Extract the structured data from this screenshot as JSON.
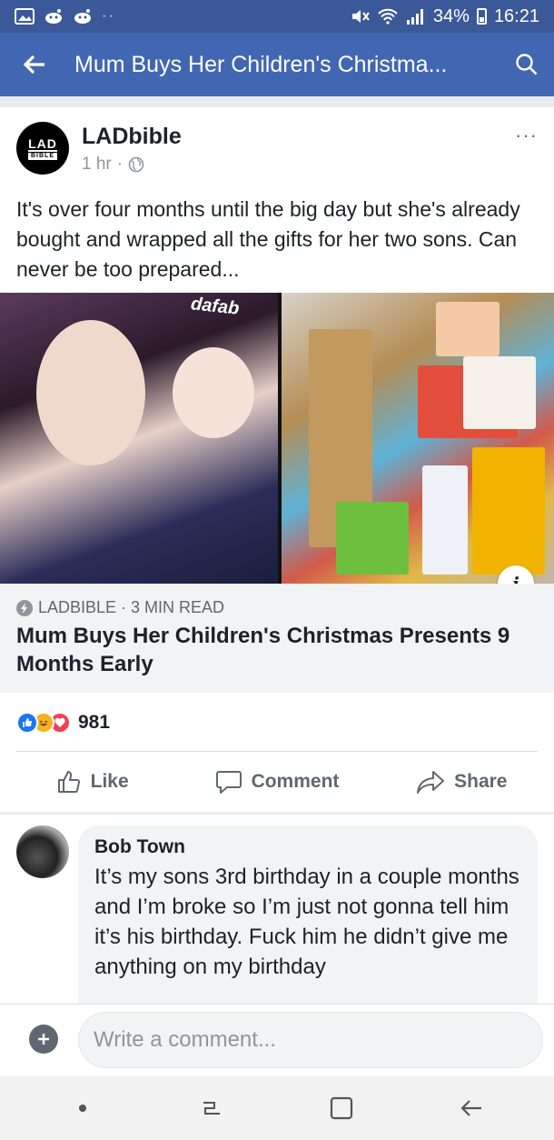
{
  "status_bar": {
    "battery": "34%",
    "time": "16:21",
    "dots": "··"
  },
  "app_bar": {
    "title": "Mum Buys Her Children's Christma..."
  },
  "post": {
    "page_name": "LADbible",
    "avatar_text_top": "LAD",
    "avatar_text_bottom": "BIBLE",
    "time": "1 hr",
    "separator": "·",
    "more": "···",
    "text": "It's over four months until the big day but she's already bought and wrapped all the gifts for her two sons. Can never be too prepared...",
    "image_watermark": "dafab",
    "info_glyph": "i",
    "link": {
      "source": "LADBIBLE · 3 MIN READ",
      "title": "Mum Buys Her Children's Christmas Presents 9 Months Early"
    },
    "reactions": {
      "count": "981"
    },
    "actions": {
      "like": "Like",
      "comment": "Comment",
      "share": "Share"
    }
  },
  "comments": [
    {
      "author": "Bob Town",
      "text": "It’s my sons 3rd birthday in a couple months and I’m broke so I’m just not gonna tell him it’s his birthday. Fuck him he didn’t give me anything on my birthday"
    }
  ],
  "composer": {
    "placeholder": "Write a comment..."
  },
  "colors": {
    "status_bar": "#3b5998",
    "app_bar": "#4267b2",
    "like_blue": "#1877f2",
    "haha_yellow": "#f7b125",
    "love_red": "#f33e58"
  }
}
